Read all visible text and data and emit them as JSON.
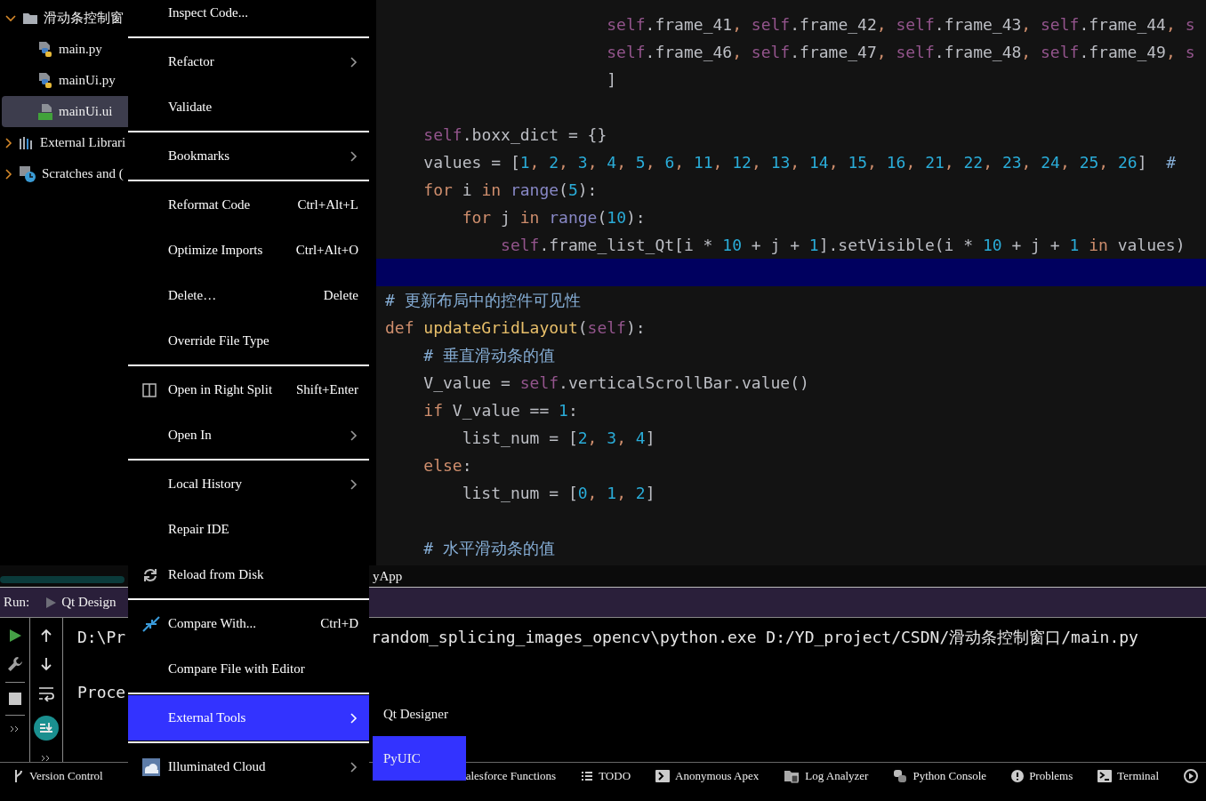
{
  "project_tree": [
    {
      "label": "滑动条控制窗",
      "kind": "folder",
      "expanded": true,
      "selected": false,
      "children": [
        {
          "label": "main.py",
          "kind": "python",
          "selected": false
        },
        {
          "label": "mainUi.py",
          "kind": "python",
          "selected": false
        },
        {
          "label": "mainUi.ui",
          "kind": "qt",
          "selected": true
        }
      ]
    },
    {
      "label": "External Librari",
      "kind": "library",
      "expanded": false,
      "selected": false
    },
    {
      "label": "Scratches and (",
      "kind": "scratch",
      "expanded": false,
      "selected": false
    }
  ],
  "editor": {
    "lines": [
      {
        "highlighted": false,
        "tokens": [
          {
            "text": "                       self",
            "kind": "self"
          },
          {
            "text": ".frame_41",
            "kind": "plain"
          },
          {
            "text": ", ",
            "kind": "comma"
          },
          {
            "text": "self",
            "kind": "self"
          },
          {
            "text": ".frame_42",
            "kind": "plain"
          },
          {
            "text": ", ",
            "kind": "comma"
          },
          {
            "text": "self",
            "kind": "self"
          },
          {
            "text": ".frame_43",
            "kind": "plain"
          },
          {
            "text": ", ",
            "kind": "comma"
          },
          {
            "text": "self",
            "kind": "self"
          },
          {
            "text": ".frame_44",
            "kind": "plain"
          },
          {
            "text": ", ",
            "kind": "comma"
          },
          {
            "text": "s",
            "kind": "self"
          }
        ]
      },
      {
        "highlighted": false,
        "tokens": [
          {
            "text": "                       self",
            "kind": "self"
          },
          {
            "text": ".frame_46",
            "kind": "plain"
          },
          {
            "text": ", ",
            "kind": "comma"
          },
          {
            "text": "self",
            "kind": "self"
          },
          {
            "text": ".frame_47",
            "kind": "plain"
          },
          {
            "text": ", ",
            "kind": "comma"
          },
          {
            "text": "self",
            "kind": "self"
          },
          {
            "text": ".frame_48",
            "kind": "plain"
          },
          {
            "text": ", ",
            "kind": "comma"
          },
          {
            "text": "self",
            "kind": "self"
          },
          {
            "text": ".frame_49",
            "kind": "plain"
          },
          {
            "text": ", ",
            "kind": "comma"
          },
          {
            "text": "s",
            "kind": "self"
          }
        ]
      },
      {
        "highlighted": false,
        "tokens": [
          {
            "text": "                       ]",
            "kind": "plain"
          }
        ]
      },
      {
        "highlighted": false
      },
      {
        "highlighted": false,
        "tokens": [
          {
            "text": "    self",
            "kind": "self"
          },
          {
            "text": ".boxx_dict = {}",
            "kind": "plain"
          }
        ]
      },
      {
        "highlighted": false,
        "tokens": [
          {
            "text": "    values = [",
            "kind": "plain"
          },
          {
            "text": "1",
            "kind": "number"
          },
          {
            "text": ", ",
            "kind": "comma"
          },
          {
            "text": "2",
            "kind": "number"
          },
          {
            "text": ", ",
            "kind": "comma"
          },
          {
            "text": "3",
            "kind": "number"
          },
          {
            "text": ", ",
            "kind": "comma"
          },
          {
            "text": "4",
            "kind": "number"
          },
          {
            "text": ", ",
            "kind": "comma"
          },
          {
            "text": "5",
            "kind": "number"
          },
          {
            "text": ", ",
            "kind": "comma"
          },
          {
            "text": "6",
            "kind": "number"
          },
          {
            "text": ", ",
            "kind": "comma"
          },
          {
            "text": "11",
            "kind": "number"
          },
          {
            "text": ", ",
            "kind": "comma"
          },
          {
            "text": "12",
            "kind": "number"
          },
          {
            "text": ", ",
            "kind": "comma"
          },
          {
            "text": "13",
            "kind": "number"
          },
          {
            "text": ", ",
            "kind": "comma"
          },
          {
            "text": "14",
            "kind": "number"
          },
          {
            "text": ", ",
            "kind": "comma"
          },
          {
            "text": "15",
            "kind": "number"
          },
          {
            "text": ", ",
            "kind": "comma"
          },
          {
            "text": "16",
            "kind": "number"
          },
          {
            "text": ", ",
            "kind": "comma"
          },
          {
            "text": "21",
            "kind": "number"
          },
          {
            "text": ", ",
            "kind": "comma"
          },
          {
            "text": "22",
            "kind": "number"
          },
          {
            "text": ", ",
            "kind": "comma"
          },
          {
            "text": "23",
            "kind": "number"
          },
          {
            "text": ", ",
            "kind": "comma"
          },
          {
            "text": "24",
            "kind": "number"
          },
          {
            "text": ", ",
            "kind": "comma"
          },
          {
            "text": "25",
            "kind": "number"
          },
          {
            "text": ", ",
            "kind": "comma"
          },
          {
            "text": "26",
            "kind": "number"
          },
          {
            "text": "]",
            "kind": "plain"
          },
          {
            "text": "  #",
            "kind": "comment"
          }
        ]
      },
      {
        "highlighted": false,
        "tokens": [
          {
            "text": "    for",
            "kind": "keyword"
          },
          {
            "text": " i ",
            "kind": "plain"
          },
          {
            "text": "in",
            "kind": "keyword"
          },
          {
            "text": " range",
            "kind": "builtin"
          },
          {
            "text": "(",
            "kind": "plain"
          },
          {
            "text": "5",
            "kind": "number"
          },
          {
            "text": "):",
            "kind": "plain"
          }
        ]
      },
      {
        "highlighted": false,
        "tokens": [
          {
            "text": "        for",
            "kind": "keyword"
          },
          {
            "text": " j ",
            "kind": "plain"
          },
          {
            "text": "in",
            "kind": "keyword"
          },
          {
            "text": " range",
            "kind": "builtin"
          },
          {
            "text": "(",
            "kind": "plain"
          },
          {
            "text": "10",
            "kind": "number"
          },
          {
            "text": "):",
            "kind": "plain"
          }
        ]
      },
      {
        "highlighted": false,
        "tokens": [
          {
            "text": "            self",
            "kind": "self"
          },
          {
            "text": ".frame_list_Qt[i * ",
            "kind": "plain"
          },
          {
            "text": "10",
            "kind": "number"
          },
          {
            "text": " + j + ",
            "kind": "plain"
          },
          {
            "text": "1",
            "kind": "number"
          },
          {
            "text": "].setVisible(i * ",
            "kind": "plain"
          },
          {
            "text": "10",
            "kind": "number"
          },
          {
            "text": " + j + ",
            "kind": "plain"
          },
          {
            "text": "1",
            "kind": "number"
          },
          {
            "text": " in",
            "kind": "keyword"
          },
          {
            "text": " values)",
            "kind": "plain"
          }
        ]
      },
      {
        "highlighted": true
      },
      {
        "highlighted": false,
        "tokens": [
          {
            "text": "# 更新布局中的控件可见性",
            "kind": "comment"
          }
        ]
      },
      {
        "highlighted": false,
        "tokens": [
          {
            "text": "def",
            "kind": "keyword"
          },
          {
            "text": " updateGridLayout",
            "kind": "function"
          },
          {
            "text": "(",
            "kind": "plain"
          },
          {
            "text": "self",
            "kind": "self"
          },
          {
            "text": "):",
            "kind": "plain"
          }
        ]
      },
      {
        "highlighted": false,
        "tokens": [
          {
            "text": "    # 垂直滑动条的值",
            "kind": "comment"
          }
        ]
      },
      {
        "highlighted": false,
        "tokens": [
          {
            "text": "    V_value = ",
            "kind": "plain"
          },
          {
            "text": "self",
            "kind": "self"
          },
          {
            "text": ".verticalScrollBar.value()",
            "kind": "plain"
          }
        ]
      },
      {
        "highlighted": false,
        "tokens": [
          {
            "text": "    if",
            "kind": "keyword"
          },
          {
            "text": " V_value == ",
            "kind": "plain"
          },
          {
            "text": "1",
            "kind": "number"
          },
          {
            "text": ":",
            "kind": "plain"
          }
        ]
      },
      {
        "highlighted": false,
        "tokens": [
          {
            "text": "        list_num = [",
            "kind": "plain"
          },
          {
            "text": "2",
            "kind": "number"
          },
          {
            "text": ", ",
            "kind": "comma"
          },
          {
            "text": "3",
            "kind": "number"
          },
          {
            "text": ", ",
            "kind": "comma"
          },
          {
            "text": "4",
            "kind": "number"
          },
          {
            "text": "]",
            "kind": "plain"
          }
        ]
      },
      {
        "highlighted": false,
        "tokens": [
          {
            "text": "    else",
            "kind": "keyword"
          },
          {
            "text": ":",
            "kind": "plain"
          }
        ]
      },
      {
        "highlighted": false,
        "tokens": [
          {
            "text": "        list_num = [",
            "kind": "plain"
          },
          {
            "text": "0",
            "kind": "number"
          },
          {
            "text": ", ",
            "kind": "comma"
          },
          {
            "text": "1",
            "kind": "number"
          },
          {
            "text": ", ",
            "kind": "comma"
          },
          {
            "text": "2",
            "kind": "number"
          },
          {
            "text": "]",
            "kind": "plain"
          }
        ]
      },
      {
        "highlighted": false
      },
      {
        "highlighted": false,
        "tokens": [
          {
            "text": "    # 水平滑动条的值",
            "kind": "comment"
          }
        ]
      }
    ]
  },
  "editor_tab_strip": {
    "title": "yApp"
  },
  "run_panel": {
    "label": "Run:",
    "tab": "Qt Design",
    "console_lines": [
      {
        "left": "D:\\Pr",
        "right": "random_splicing_images_opencv\\python.exe D:/YD_project/CSDN/滑动条控制窗口/main.py"
      },
      {
        "left": "Proce"
      }
    ]
  },
  "tool_strip": [
    {
      "label": "Version Control",
      "kind": "branch"
    },
    {
      "label": "alesforce Functions",
      "kind": "plain"
    },
    {
      "label": "TODO",
      "kind": "list"
    },
    {
      "label": "Anonymous Apex",
      "kind": "prompt"
    },
    {
      "label": "Log Analyzer",
      "kind": "log"
    },
    {
      "label": "Python Console",
      "kind": "python"
    },
    {
      "label": "Problems",
      "kind": "problems"
    },
    {
      "label": "Terminal",
      "kind": "terminal"
    },
    {
      "kind": "run"
    }
  ],
  "context_menu": {
    "groups": [
      [
        {
          "label": "Inspect Code...",
          "kind": "plain",
          "selected": false
        }
      ],
      [
        {
          "label": "Refactor",
          "kind": "plain",
          "submenu": true,
          "selected": false
        },
        {
          "label": "Validate",
          "kind": "plain",
          "selected": false
        }
      ],
      [
        {
          "label": "Bookmarks",
          "kind": "plain",
          "submenu": true,
          "selected": false
        }
      ],
      [
        {
          "label": "Reformat Code",
          "kind": "plain",
          "shortcut": "Ctrl+Alt+L",
          "selected": false
        },
        {
          "label": "Optimize Imports",
          "kind": "plain",
          "shortcut": "Ctrl+Alt+O",
          "selected": false
        },
        {
          "label": "Delete…",
          "kind": "plain",
          "shortcut": "Delete",
          "selected": false
        },
        {
          "label": "Override File Type",
          "kind": "plain",
          "selected": false
        }
      ],
      [
        {
          "label": "Open in Right Split",
          "kind": "split",
          "shortcut": "Shift+Enter",
          "selected": false
        },
        {
          "label": "Open In",
          "kind": "plain",
          "submenu": true,
          "selected": false
        }
      ],
      [
        {
          "label": "Local History",
          "kind": "plain",
          "submenu": true,
          "selected": false
        },
        {
          "label": "Repair IDE",
          "kind": "plain",
          "selected": false
        },
        {
          "label": "Reload from Disk",
          "kind": "reload",
          "selected": false
        }
      ],
      [
        {
          "label": "Compare With...",
          "kind": "compare",
          "shortcut": "Ctrl+D",
          "selected": false
        },
        {
          "label": "Compare File with Editor",
          "kind": "plain",
          "selected": false
        }
      ],
      [
        {
          "label": "External Tools",
          "kind": "plain",
          "submenu": true,
          "selected": true
        }
      ],
      [
        {
          "label": "Illuminated Cloud",
          "kind": "cloud",
          "submenu": true,
          "selected": false
        }
      ]
    ]
  },
  "submenu": {
    "items": [
      {
        "label": "Qt Designer",
        "selected": false
      },
      {
        "label": "PyUIC",
        "selected": true
      }
    ]
  }
}
